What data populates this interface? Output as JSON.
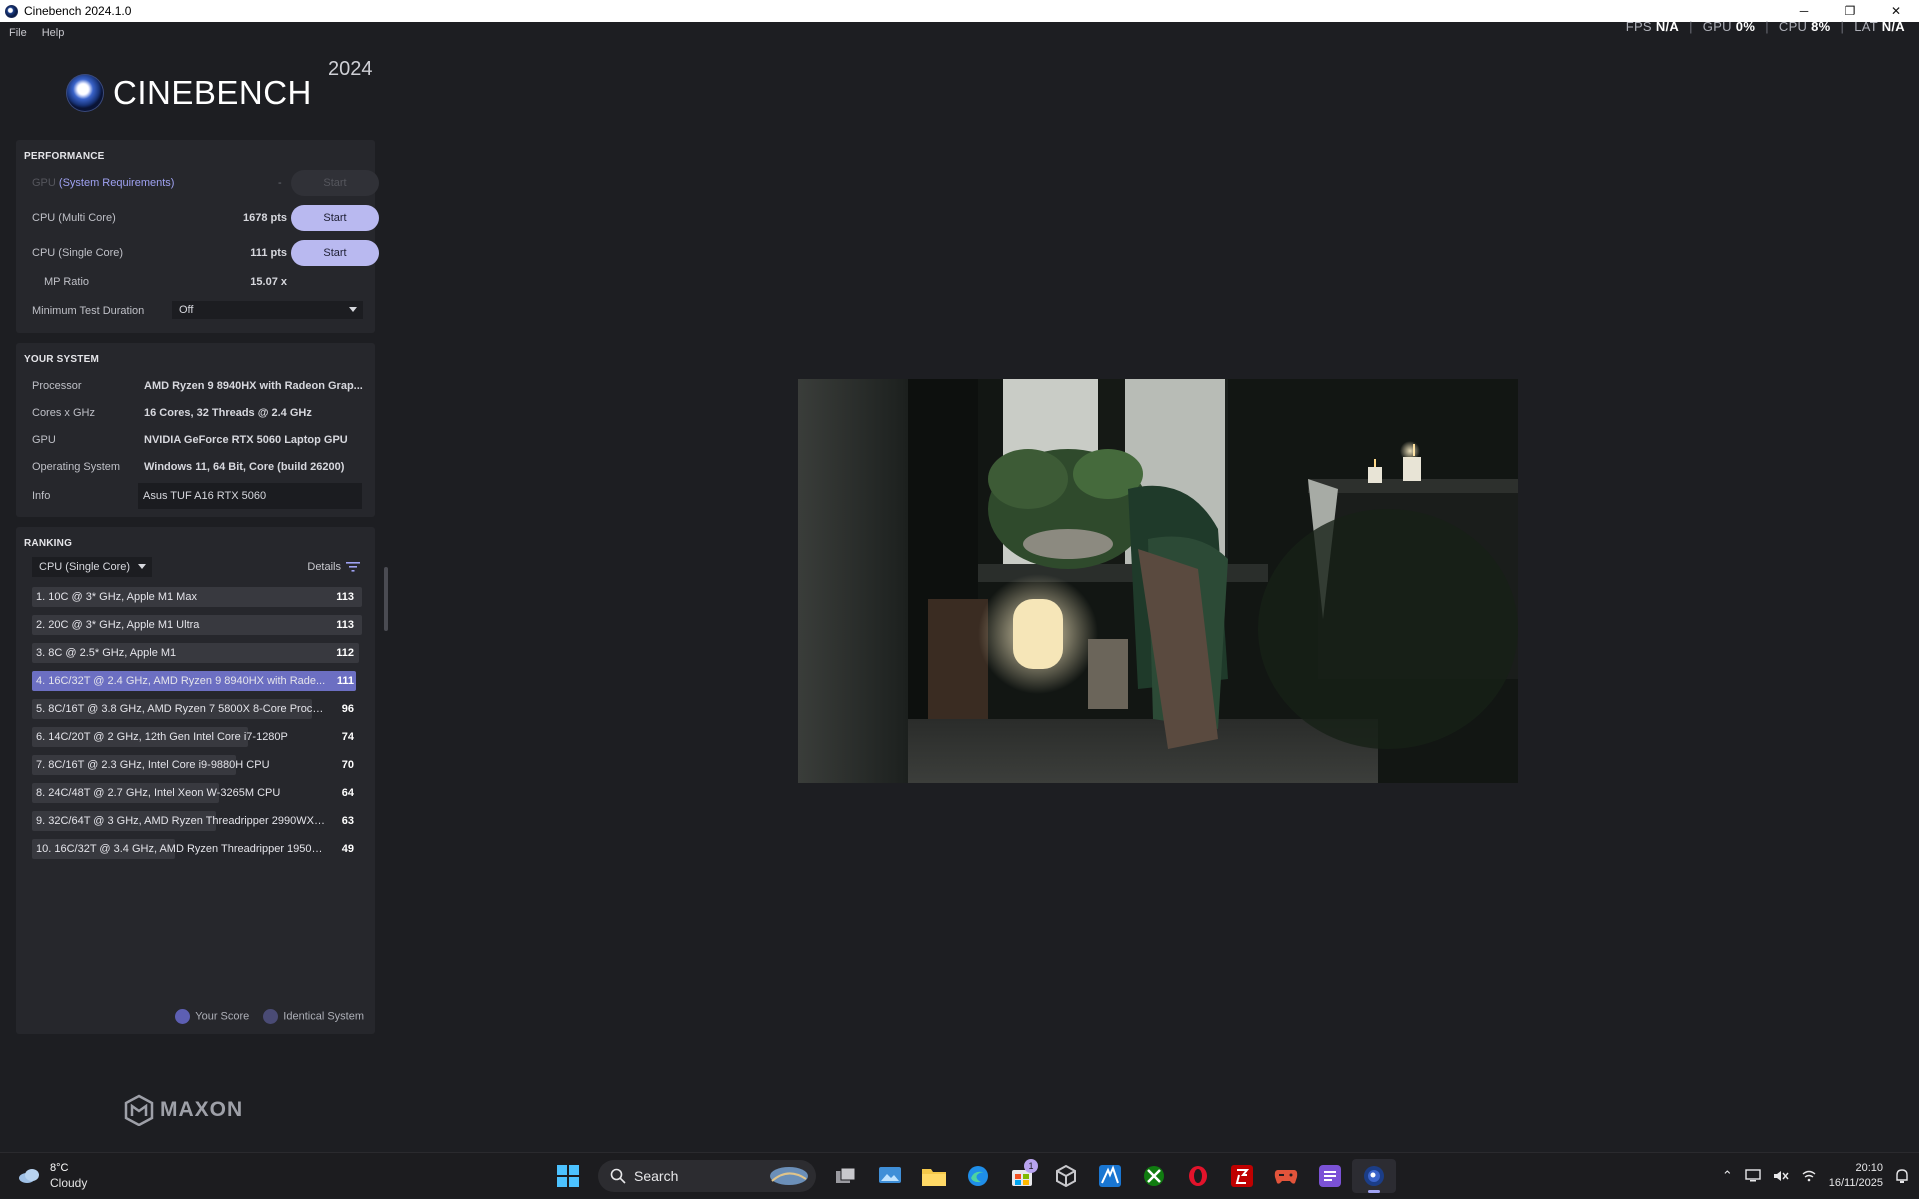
{
  "window": {
    "title": "Cinebench 2024.1.0"
  },
  "menu": [
    "File",
    "Help"
  ],
  "hud": {
    "fps_label": "FPS",
    "fps_value": "N/A",
    "gpu_label": "GPU",
    "gpu_value": "0%",
    "cpu_label": "CPU",
    "cpu_value": "8%",
    "lat_label": "LAT",
    "lat_value": "N/A",
    "separator": "|"
  },
  "logo": {
    "word": "CINEBENCH",
    "year": "2024"
  },
  "performance": {
    "title": "PERFORMANCE",
    "gpu_label": "GPU",
    "gpu_link": "(System Requirements)",
    "gpu_value": "-",
    "multi_label": "CPU (Multi Core)",
    "multi_value": "1678 pts",
    "single_label": "CPU (Single Core)",
    "single_value": "111 pts",
    "mp_label": "MP Ratio",
    "mp_value": "15.07 x",
    "min_duration_label": "Minimum Test Duration",
    "min_duration_value": "Off",
    "start_label": "Start"
  },
  "system": {
    "title": "YOUR SYSTEM",
    "rows": [
      {
        "label": "Processor",
        "value": "AMD Ryzen 9 8940HX with Radeon Grap..."
      },
      {
        "label": "Cores x GHz",
        "value": "16 Cores, 32 Threads @ 2.4 GHz"
      },
      {
        "label": "GPU",
        "value": "NVIDIA GeForce RTX 5060 Laptop GPU"
      },
      {
        "label": "Operating System",
        "value": "Windows 11, 64 Bit, Core (build 26200)"
      }
    ],
    "info_label": "Info",
    "info_value": "Asus TUF A16 RTX  5060"
  },
  "ranking": {
    "title": "RANKING",
    "mode": "CPU (Single Core)",
    "details_label": "Details",
    "entries": [
      {
        "label": "1. 10C @ 3* GHz, Apple M1 Max",
        "score": "113",
        "value": 113
      },
      {
        "label": "2. 20C @ 3* GHz, Apple M1 Ultra",
        "score": "113",
        "value": 113
      },
      {
        "label": "3. 8C @ 2.5* GHz, Apple M1",
        "score": "112",
        "value": 112
      },
      {
        "label": "4. 16C/32T @ 2.4 GHz, AMD Ryzen 9 8940HX with Rade...",
        "score": "111",
        "value": 111,
        "mine": true
      },
      {
        "label": "5. 8C/16T @ 3.8 GHz, AMD Ryzen 7 5800X 8-Core Proces...",
        "score": "96",
        "value": 96
      },
      {
        "label": "6. 14C/20T @ 2 GHz, 12th Gen Intel Core i7-1280P",
        "score": "74",
        "value": 74
      },
      {
        "label": "7. 8C/16T @ 2.3 GHz, Intel Core i9-9880H CPU",
        "score": "70",
        "value": 70
      },
      {
        "label": "8. 24C/48T @ 2.7 GHz, Intel Xeon W-3265M CPU",
        "score": "64",
        "value": 64
      },
      {
        "label": "9. 32C/64T @ 3 GHz, AMD Ryzen Threadripper 2990WX 3...",
        "score": "63",
        "value": 63
      },
      {
        "label": "10. 16C/32T @ 3.4 GHz, AMD Ryzen Threadripper 1950X ...",
        "score": "49",
        "value": 49
      }
    ],
    "legend_your": "Your Score",
    "legend_identical": "Identical System"
  },
  "maxon": {
    "word": "MAXON"
  },
  "colors": {
    "accent": "#b9b9f0",
    "my_bar": "#6c6fc2",
    "your_dot": "#5d5fb3",
    "identical_dot": "#4a4b75"
  },
  "taskbar": {
    "weather_temp": "8°C",
    "weather_cond": "Cloudy",
    "search_placeholder": "Search",
    "store_badge": "1",
    "time": "20:10",
    "date": "16/11/2025"
  }
}
